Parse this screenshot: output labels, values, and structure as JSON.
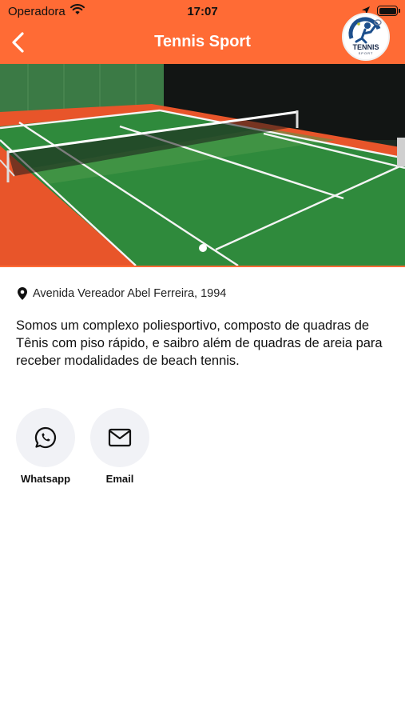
{
  "status_bar": {
    "carrier": "Operadora",
    "time": "17:07"
  },
  "nav": {
    "title": "Tennis Sport",
    "back_icon": "chevron-left-icon"
  },
  "logo": {
    "text": "TENNIS",
    "subtext": "SPORT"
  },
  "carousel": {
    "image": "tennis-court-photo",
    "page_count": 1,
    "active_page": 1
  },
  "venue": {
    "address": "Avenida Vereador Abel Ferreira, 1994",
    "description": "Somos um complexo poliesportivo, composto de quadras de Tênis com piso rápido, e saibro além de quadras de areia para receber modalidades de beach tennis."
  },
  "contacts": [
    {
      "label": "Whatsapp",
      "icon": "whatsapp-icon"
    },
    {
      "label": "Email",
      "icon": "mail-icon"
    }
  ],
  "colors": {
    "accent": "#ff6b35",
    "court_green": "#2f8a3c",
    "court_clay": "#e8552a",
    "button_bg": "#f1f2f6"
  }
}
